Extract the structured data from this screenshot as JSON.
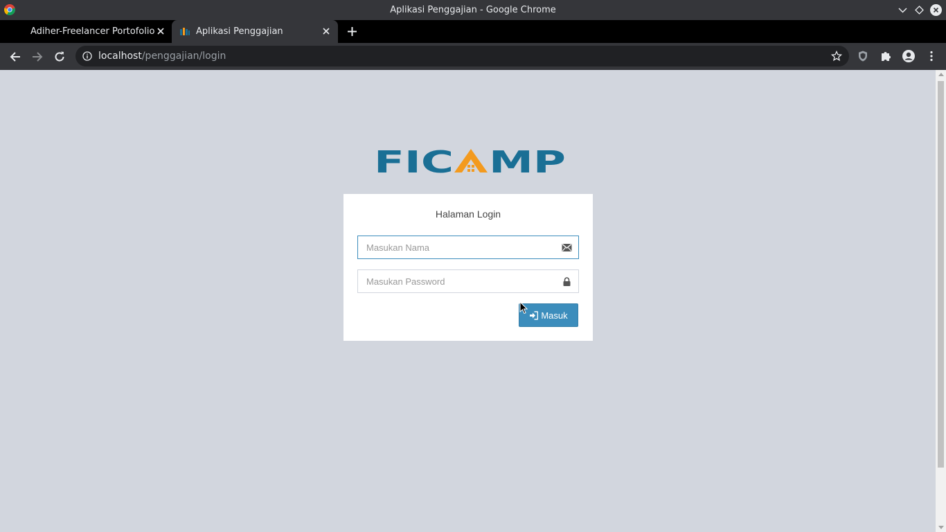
{
  "window": {
    "title": "Aplikasi Penggajian - Google Chrome"
  },
  "tabs": [
    {
      "label": "Adiher-Freelancer Portofolio",
      "active": false
    },
    {
      "label": "Aplikasi Penggajian",
      "active": true
    }
  ],
  "toolbar": {
    "url_host": "localhost",
    "url_path": "/penggajian/login"
  },
  "page": {
    "logo_text": "FICAMP",
    "login": {
      "title": "Halaman Login",
      "username_placeholder": "Masukan Nama",
      "password_placeholder": "Masukan Password",
      "submit_label": "Masuk"
    }
  },
  "colors": {
    "page_bg": "#d2d6de",
    "primary": "#3c8dbc",
    "logo_blue": "#1a6f95",
    "logo_orange": "#f39a1e"
  },
  "icons": {
    "username_field": "envelope-icon",
    "password_field": "lock-icon",
    "submit_button": "sign-in-icon"
  }
}
